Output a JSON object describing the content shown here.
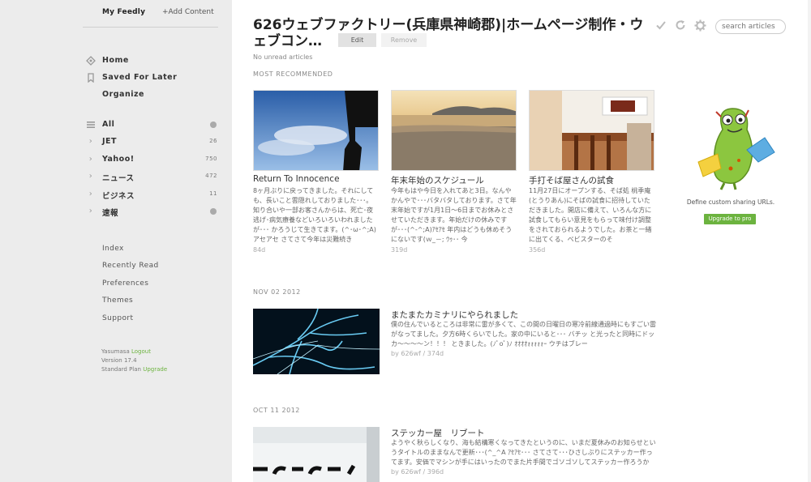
{
  "sidebar": {
    "tabs": {
      "my_feedly": "My Feedly",
      "add_content": "+Add Content"
    },
    "nav": [
      {
        "label": "Home",
        "icon": "home-icon"
      },
      {
        "label": "Saved For Later",
        "icon": "bookmark-icon"
      },
      {
        "label": "Organize",
        "icon": ""
      }
    ],
    "all": {
      "label": "All",
      "icon": "list-icon"
    },
    "feeds": [
      {
        "label": "JET",
        "count": "26"
      },
      {
        "label": "Yahoo!",
        "count": "750"
      },
      {
        "label": "ニュース",
        "count": "472"
      },
      {
        "label": "ビジネス",
        "count": "11"
      },
      {
        "label": "速報",
        "count": ""
      }
    ],
    "links": [
      "Index",
      "Recently Read",
      "Preferences",
      "Themes",
      "Support"
    ],
    "account": {
      "user": "Yasumasa",
      "logout": "Logout",
      "version": "Version 17.4",
      "plan": "Standard Plan",
      "upgrade": "Upgrade"
    }
  },
  "main": {
    "title": "626ウェブファクトリー(兵庫県神崎郡)|ホームページ制作・ウェブコン…",
    "edit": "Edit",
    "remove": "Remove",
    "unread": "No unread articles",
    "search_placeholder": "search articles",
    "tools": [
      "checkmark-icon",
      "refresh-icon",
      "gear-icon"
    ],
    "most_recommended": "MOST RECOMMENDED",
    "cards": [
      {
        "title": "Return To Innocence",
        "snippet": "8ヶ月ぶりに戻ってきました。それにしても、長いこと雲隠れしておりました･･･。知り合いや一部お客さんからは、死亡･夜逃げ･病気療養などいろいろいわれましたが･･･ かろうじて生きてます。(^･ω･^;A) アセアセ さてさて今年は災難続き",
        "age": "84d"
      },
      {
        "title": "年末年始のスケジュール",
        "snippet": "今年もはや今日を入れてあと3日。なんやかんやで･･･バタバタしております。さて年末年始ですが1月1日〜6日までお休みとさせていただきます。年始だけの休みですが･･･(^-^;A)ｱｾｱｾ 年内はどうも休めそうにないです(ｗ_－; ｳｩ･･ 今",
        "age": "319d"
      },
      {
        "title": "手打そば屋さんの試食",
        "snippet": "11月27日にオープンする、そば処 桃季庵(とうりあん)にそばの試食に招待していただきました。開店に備えて、いろんな方に試食してもらい意見をもらって味付け調整をされておられるようでした。お茶と一緒に出てくる、ベビスターのそ",
        "age": "356d"
      }
    ],
    "sections": [
      {
        "date": "NOV 02 2012",
        "entry": {
          "title": "またまたカミナリにやられました",
          "snippet": "僕の住んでいるところは非常に雷が多くて、この間の日曜日の寒冷前線通過時にもすごい雷がなってました。夕方6時くらいでした。家の中にいると･･･ バチッ と光ったと同時にドッカ〜〜〜〜ン！！！ ときました。(ﾉﾟoﾟ)ﾉ ｵｵｵｵｫｫｫｫｫｰ ウチはブレー",
          "meta": "by 626wf / 374d"
        }
      },
      {
        "date": "OCT 11 2012",
        "entry": {
          "title": "ステッカー屋　リブート",
          "snippet": "ようやく秋らしくなり、海も結構寒くなってきたというのに、いまだ夏休みのお知らせというタイトルのままなんで更新･･･(^_^A ｱｾｱｾ･･･ さてさて･･･ひさしぶりにステッカー作ってます。安価でマシンが手にはいったのでまた片手間でゴソゴソしてステッカー作ろうか",
          "meta": "by 626wf / 396d"
        }
      }
    ],
    "promo": {
      "text": "Define custom sharing URLs.",
      "button": "Upgrade to pro"
    }
  },
  "colors": {
    "accent_green": "#6cb33f",
    "sidebar_bg": "#ececec"
  }
}
